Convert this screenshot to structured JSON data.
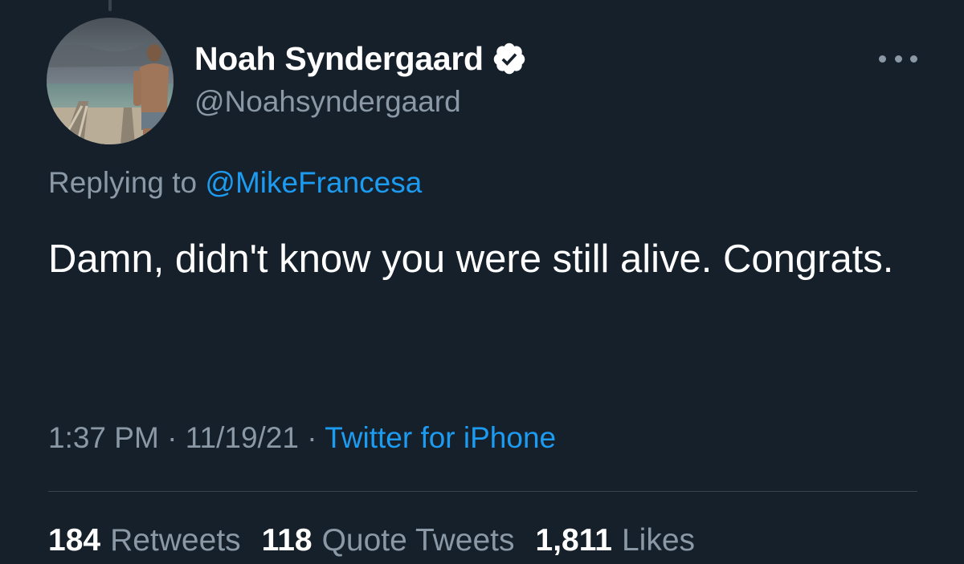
{
  "colors": {
    "background": "#15202b",
    "primary_text": "#ffffff",
    "secondary_text": "#8b98a5",
    "link": "#1d9bf0",
    "divider": "#38444d"
  },
  "author": {
    "display_name": "Noah Syndergaard",
    "handle": "@Noahsyndergaard",
    "verified": true,
    "avatar_icon": "profile-photo"
  },
  "reply": {
    "prefix": "Replying to",
    "to_handle": "@MikeFrancesa"
  },
  "tweet": {
    "text": "Damn, didn't know you were still alive. Congrats."
  },
  "meta": {
    "time": "1:37 PM",
    "date": "11/19/21",
    "separator": "·",
    "source": "Twitter for iPhone"
  },
  "stats": {
    "retweets": {
      "count": "184",
      "label": "Retweets"
    },
    "quote_tweets": {
      "count": "118",
      "label": "Quote Tweets"
    },
    "likes": {
      "count": "1,811",
      "label": "Likes"
    }
  },
  "icons": {
    "more": "more-options-icon",
    "verified": "verified-badge-icon"
  }
}
